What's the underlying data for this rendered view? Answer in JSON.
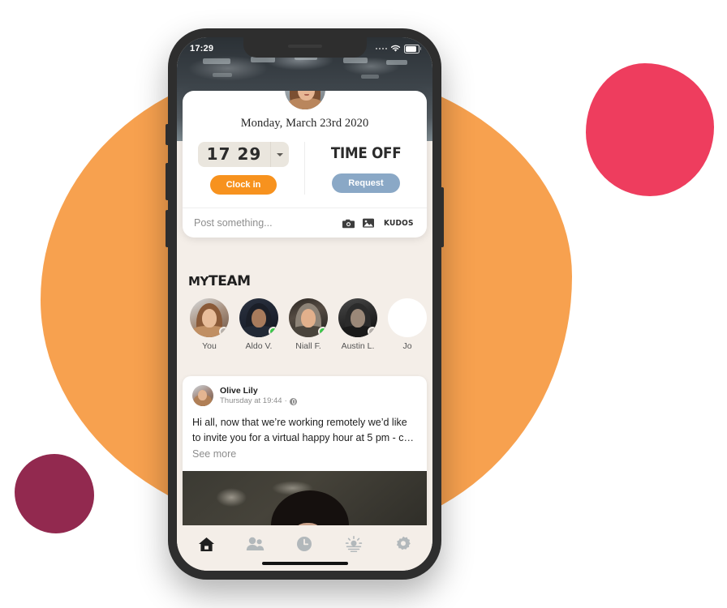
{
  "colors": {
    "blob_orange": "#f7a14f",
    "blob_pink": "#ee3d5e",
    "blob_magenta": "#92294f",
    "accent_orange": "#f7921e",
    "accent_blue": "#8aa8c6",
    "app_background": "#f4eee8",
    "online_green": "#3cc84a",
    "offline_gray": "#b5b0ab",
    "phone_frame": "#2e2e2e"
  },
  "status_bar": {
    "time": "17:29",
    "signal_icon": "signal-dots-icon",
    "wifi_icon": "wifi-icon",
    "battery_icon": "battery-icon"
  },
  "top_card": {
    "avatar_name": "user-avatar",
    "date": "Monday, March 23rd 2020",
    "clock": {
      "hours": "17",
      "minutes": "29",
      "dropdown_icon": "chevron-down-icon",
      "clock_in_label": "Clock in"
    },
    "time_off": {
      "title": "TIME OFF",
      "request_label": "Request"
    },
    "composer": {
      "placeholder": "Post something...",
      "camera_icon": "camera-icon",
      "photo_icon": "photo-icon",
      "kudos_label": "KUDOS"
    }
  },
  "team": {
    "title_prefix": "MY",
    "title_main": "TEAM",
    "members": [
      {
        "name": "You",
        "status": "offline"
      },
      {
        "name": "Aldo V.",
        "status": "online"
      },
      {
        "name": "Niall F.",
        "status": "online"
      },
      {
        "name": "Austin L.",
        "status": "offline"
      },
      {
        "name": "Jo",
        "status": "none"
      }
    ]
  },
  "post": {
    "author": "Olive Lily",
    "timestamp": "Thursday at 19:44",
    "separator": "·",
    "visibility_icon": "globe-icon",
    "text": "Hi all, now that we’re working remotely we’d like to invite you for a virtual happy hour at 5 pm - c…",
    "see_more": "See more"
  },
  "tabbar": {
    "items": [
      {
        "icon": "home-icon",
        "active": true
      },
      {
        "icon": "people-icon",
        "active": false
      },
      {
        "icon": "clock-icon",
        "active": false
      },
      {
        "icon": "weather-icon",
        "active": false
      },
      {
        "icon": "gear-icon",
        "active": false
      }
    ]
  }
}
